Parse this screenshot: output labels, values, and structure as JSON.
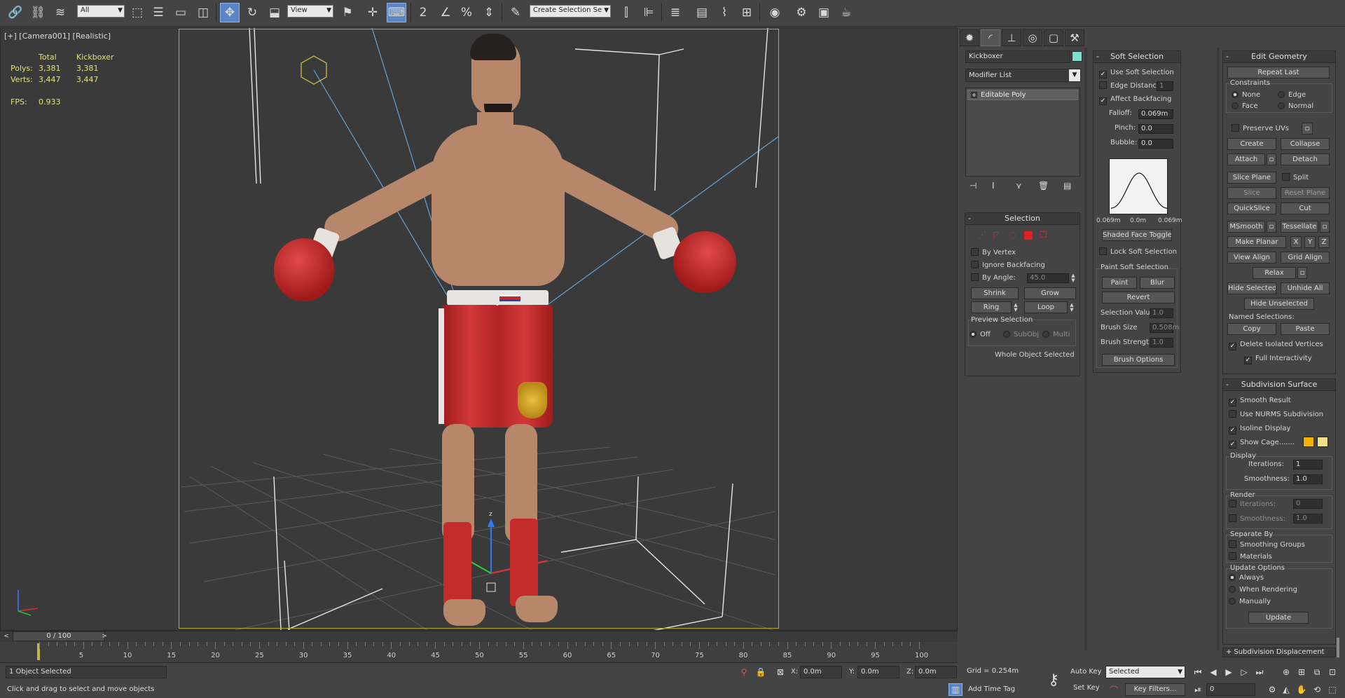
{
  "toolbar": {
    "selection_filter": "All",
    "ref_coord_system": "View",
    "named_selection_set": "Create Selection Se"
  },
  "viewport": {
    "label": "[+] [Camera001] [Realistic]",
    "stats": {
      "col_total": "Total",
      "col_object": "Kickboxer",
      "polys_label": "Polys:",
      "polys_total": "3,381",
      "polys_object": "3,381",
      "verts_label": "Verts:",
      "verts_total": "3,447",
      "verts_object": "3,447",
      "fps_label": "FPS:",
      "fps_value": "0.933"
    },
    "gizmo_z": "z"
  },
  "command_panel": {
    "object_name": "Kickboxer",
    "object_color": "#7fe0d0",
    "modifier_list": "Modifier List",
    "stack_items": [
      "Editable Poly"
    ],
    "selection": {
      "title": "Selection",
      "by_vertex": "By Vertex",
      "ignore_backfacing": "Ignore Backfacing",
      "by_angle": "By Angle:",
      "by_angle_value": "45.0",
      "shrink": "Shrink",
      "grow": "Grow",
      "ring": "Ring",
      "loop": "Loop",
      "preview_selection": "Preview Selection",
      "preview_off": "Off",
      "preview_subobj": "SubObj",
      "preview_multi": "Multi",
      "status": "Whole Object Selected"
    },
    "soft_selection": {
      "title": "Soft Selection",
      "use_soft_selection": "Use Soft Selection",
      "edge_distance": "Edge Distance:",
      "edge_distance_value": "1",
      "affect_backfacing": "Affect Backfacing",
      "falloff": "Falloff:",
      "falloff_value": "0.069m",
      "pinch": "Pinch:",
      "pinch_value": "0.0",
      "bubble": "Bubble:",
      "bubble_value": "0.0",
      "curve_left": "0.069m",
      "curve_mid": "0.0m",
      "curve_right": "0.069m",
      "shaded_face_toggle": "Shaded Face Toggle",
      "lock_soft_selection": "Lock Soft Selection",
      "paint_soft_selection": "Paint Soft Selection",
      "paint": "Paint",
      "blur": "Blur",
      "revert": "Revert",
      "selection_value": "Selection Value",
      "selection_value_v": "1.0",
      "brush_size": "Brush Size",
      "brush_size_v": "0.508m",
      "brush_strength": "Brush Strength",
      "brush_strength_v": "1.0",
      "brush_options": "Brush Options"
    },
    "edit_geometry": {
      "title": "Edit Geometry",
      "repeat_last": "Repeat Last",
      "constraints": "Constraints",
      "none": "None",
      "edge": "Edge",
      "face": "Face",
      "normal": "Normal",
      "preserve_uvs": "Preserve UVs",
      "create": "Create",
      "collapse": "Collapse",
      "attach": "Attach",
      "detach": "Detach",
      "slice_plane": "Slice Plane",
      "split": "Split",
      "slice": "Slice",
      "reset_plane": "Reset Plane",
      "quickslice": "QuickSlice",
      "cut": "Cut",
      "msmooth": "MSmooth",
      "tessellate": "Tessellate",
      "make_planar": "Make Planar",
      "x": "X",
      "y": "Y",
      "z": "Z",
      "view_align": "View Align",
      "grid_align": "Grid Align",
      "relax": "Relax",
      "hide_selected": "Hide Selected",
      "unhide_all": "Unhide All",
      "hide_unselected": "Hide Unselected",
      "named_selections": "Named Selections:",
      "copy": "Copy",
      "paste": "Paste",
      "delete_isolated": "Delete Isolated Vertices",
      "full_interactivity": "Full Interactivity"
    },
    "subdivision_surface": {
      "title": "Subdivision Surface",
      "smooth_result": "Smooth Result",
      "use_nurms": "Use NURMS Subdivision",
      "isoline_display": "Isoline Display",
      "show_cage": "Show Cage.......",
      "cage_color_1": "#f0b400",
      "cage_color_2": "#f0e08a",
      "display": "Display",
      "iterations": "Iterations:",
      "iterations_v": "1",
      "smoothness": "Smoothness:",
      "smoothness_v": "1.0",
      "render": "Render",
      "r_iterations_v": "0",
      "r_smoothness_v": "1.0",
      "separate_by": "Separate By",
      "smoothing_groups": "Smoothing Groups",
      "materials": "Materials",
      "update_options": "Update Options",
      "always": "Always",
      "when_rendering": "When Rendering",
      "manually": "Manually",
      "update": "Update"
    },
    "subdivision_displacement": "Subdivision Displacement"
  },
  "timeline": {
    "frame": "0 / 100",
    "ticks": [
      "5",
      "10",
      "15",
      "20",
      "25",
      "30",
      "35",
      "40",
      "45",
      "50",
      "55",
      "60",
      "65",
      "70",
      "75",
      "80",
      "85",
      "90",
      "95",
      "100"
    ]
  },
  "status": {
    "selected": "1 Object Selected",
    "prompt": "Click and drag to select and move objects",
    "x_label": "X:",
    "x_value": "0.0m",
    "y_label": "Y:",
    "y_value": "0.0m",
    "z_label": "Z:",
    "z_value": "0.0m",
    "grid": "Grid = 0.254m",
    "add_time_tag": "Add Time Tag",
    "auto_key": "Auto Key",
    "set_key": "Set Key",
    "key_mode": "Selected",
    "key_filters": "Key Filters...",
    "current_frame": "0"
  }
}
